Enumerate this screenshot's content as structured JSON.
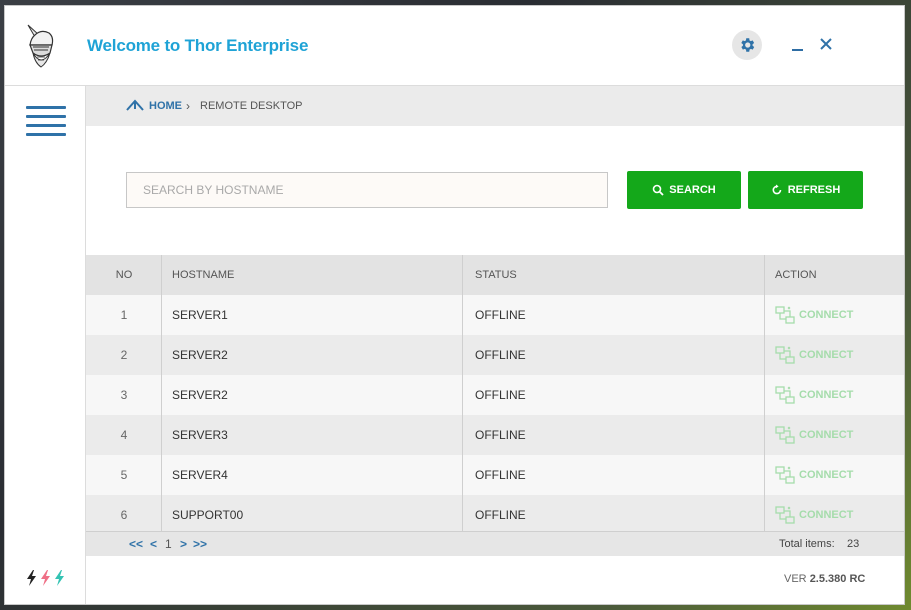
{
  "app": {
    "title": "Welcome to Thor Enterprise"
  },
  "breadcrumb": {
    "home": "HOME",
    "current": "REMOTE DESKTOP"
  },
  "search": {
    "placeholder": "SEARCH BY HOSTNAME",
    "value": ""
  },
  "buttons": {
    "search": "SEARCH",
    "refresh": "REFRESH"
  },
  "table": {
    "headers": {
      "no": "NO",
      "hostname": "HOSTNAME",
      "status": "STATUS",
      "action": "ACTION"
    },
    "rows": [
      {
        "no": "1",
        "hostname": "SERVER1",
        "status": "OFFLINE",
        "action": "CONNECT"
      },
      {
        "no": "2",
        "hostname": "SERVER2",
        "status": "OFFLINE",
        "action": "CONNECT"
      },
      {
        "no": "3",
        "hostname": "SERVER2",
        "status": "OFFLINE",
        "action": "CONNECT"
      },
      {
        "no": "4",
        "hostname": "SERVER3",
        "status": "OFFLINE",
        "action": "CONNECT"
      },
      {
        "no": "5",
        "hostname": "SERVER4",
        "status": "OFFLINE",
        "action": "CONNECT"
      },
      {
        "no": "6",
        "hostname": "SUPPORT00",
        "status": "OFFLINE",
        "action": "CONNECT"
      }
    ]
  },
  "pagination": {
    "first": "<<",
    "prev": "<",
    "page": "1",
    "next": ">",
    "last": ">>",
    "total_label": "Total items:",
    "total_value": "23"
  },
  "footer": {
    "version_label": "VER",
    "version_value": "2.5.380 RC"
  },
  "colors": {
    "accent": "#1fa3d6",
    "primary": "#2f72a8",
    "button_green": "#14a81a",
    "connect_disabled": "#a5dcab"
  },
  "icons": {
    "logo": "thor-logo-icon",
    "settings": "gear-icon",
    "minimize": "minimize-icon",
    "close": "close-icon",
    "menu": "hamburger-menu-icon",
    "home": "home-icon",
    "search": "search-icon",
    "refresh": "refresh-icon",
    "connect": "connect-icon",
    "status": "lightning-bolts-icon"
  }
}
